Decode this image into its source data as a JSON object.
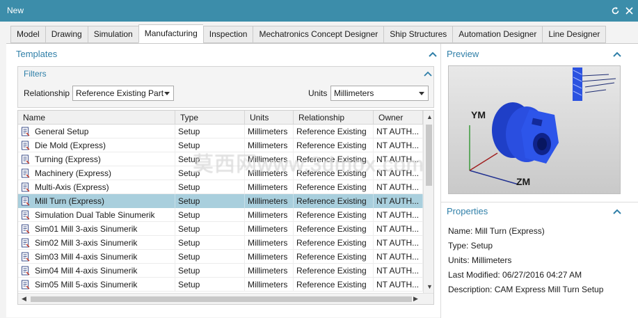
{
  "window": {
    "title": "New"
  },
  "tabs": [
    {
      "label": "Model"
    },
    {
      "label": "Drawing"
    },
    {
      "label": "Simulation"
    },
    {
      "label": "Manufacturing"
    },
    {
      "label": "Inspection"
    },
    {
      "label": "Mechatronics Concept Designer"
    },
    {
      "label": "Ship Structures"
    },
    {
      "label": "Automation Designer"
    },
    {
      "label": "Line Designer"
    }
  ],
  "active_tab": "Manufacturing",
  "templates": {
    "title": "Templates",
    "filters": {
      "title": "Filters",
      "relationship_label": "Relationship",
      "relationship_value": "Reference Existing Part",
      "units_label": "Units",
      "units_value": "Millimeters"
    },
    "columns": [
      "Name",
      "Type",
      "Units",
      "Relationship",
      "Owner"
    ],
    "rows": [
      {
        "name": "General Setup",
        "type": "Setup",
        "units": "Millimeters",
        "relationship": "Reference Existing",
        "owner": "NT AUTH..."
      },
      {
        "name": "Die Mold (Express)",
        "type": "Setup",
        "units": "Millimeters",
        "relationship": "Reference Existing",
        "owner": "NT AUTH..."
      },
      {
        "name": "Turning (Express)",
        "type": "Setup",
        "units": "Millimeters",
        "relationship": "Reference Existing",
        "owner": "NT AUTH..."
      },
      {
        "name": "Machinery (Express)",
        "type": "Setup",
        "units": "Millimeters",
        "relationship": "Reference Existing",
        "owner": "NT AUTH..."
      },
      {
        "name": "Multi-Axis (Express)",
        "type": "Setup",
        "units": "Millimeters",
        "relationship": "Reference Existing",
        "owner": "NT AUTH..."
      },
      {
        "name": "Mill Turn (Express)",
        "type": "Setup",
        "units": "Millimeters",
        "relationship": "Reference Existing",
        "owner": "NT AUTH...",
        "selected": true
      },
      {
        "name": "Simulation Dual Table Sinumerik",
        "type": "Setup",
        "units": "Millimeters",
        "relationship": "Reference Existing",
        "owner": "NT AUTH..."
      },
      {
        "name": "Sim01 Mill 3-axis Sinumerik",
        "type": "Setup",
        "units": "Millimeters",
        "relationship": "Reference Existing",
        "owner": "NT AUTH..."
      },
      {
        "name": "Sim02 Mill 3-axis Sinumerik",
        "type": "Setup",
        "units": "Millimeters",
        "relationship": "Reference Existing",
        "owner": "NT AUTH..."
      },
      {
        "name": "Sim03 Mill 4-axis Sinumerik",
        "type": "Setup",
        "units": "Millimeters",
        "relationship": "Reference Existing",
        "owner": "NT AUTH..."
      },
      {
        "name": "Sim04 Mill 4-axis Sinumerik",
        "type": "Setup",
        "units": "Millimeters",
        "relationship": "Reference Existing",
        "owner": "NT AUTH..."
      },
      {
        "name": "Sim05 Mill 5-axis Sinumerik",
        "type": "Setup",
        "units": "Millimeters",
        "relationship": "Reference Existing",
        "owner": "NT AUTH..."
      }
    ]
  },
  "preview": {
    "title": "Preview",
    "axis_labels": {
      "ym": "YM",
      "zm": "ZM"
    }
  },
  "properties": {
    "title": "Properties",
    "name": "Name: Mill Turn (Express)",
    "type": "Type: Setup",
    "units": "Units: Millimeters",
    "last_modified": "Last Modified: 06/27/2016 04:27 AM",
    "description": "Description: CAM Express Mill Turn Setup"
  },
  "watermark": "莫西网www.3dmox.com",
  "colors": {
    "titlebar": "#3c8daa",
    "section_title": "#2f7fa8",
    "selected_row": "#a9cfdd",
    "part_blue": "#1f3fc7"
  },
  "icons": [
    "refresh-icon",
    "close-icon",
    "collapse-chevron-icon",
    "dropdown-arrow-icon",
    "template-file-icon"
  ]
}
